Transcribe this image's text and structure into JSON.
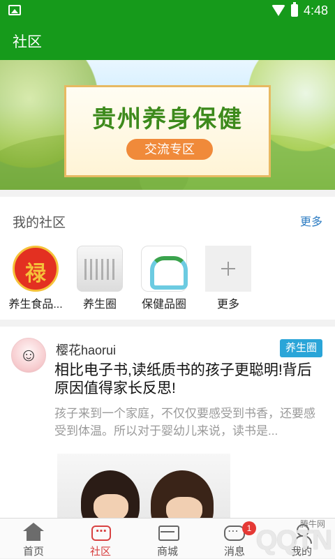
{
  "status_bar": {
    "time": "4:48"
  },
  "app_bar": {
    "title": "社区"
  },
  "banner": {
    "title": "贵州养身保健",
    "subtitle": "交流专区"
  },
  "my_communities": {
    "title": "我的社区",
    "more_label": "更多",
    "items": [
      {
        "label": "养生食品..."
      },
      {
        "label": "养生圈"
      },
      {
        "label": "保健品圈"
      },
      {
        "label": "更多"
      }
    ]
  },
  "post": {
    "username": "樱花haorui",
    "tag": "养生圈",
    "title": "相比电子书,读纸质书的孩子更聪明!背后原因值得家长反思!",
    "body": "孩子来到一个家庭，不仅仅要感受到书香，还要感受到体温。所以对于婴幼儿来说，读书是..."
  },
  "tab_bar": {
    "items": [
      {
        "label": "首页",
        "icon": "home-icon"
      },
      {
        "label": "社区",
        "icon": "community-icon",
        "active": true
      },
      {
        "label": "商城",
        "icon": "shop-icon"
      },
      {
        "label": "消息",
        "icon": "message-icon",
        "badge": "1"
      },
      {
        "label": "我的",
        "icon": "user-icon"
      }
    ]
  },
  "watermark": {
    "small": "腾牛网",
    "logo": "QQTN"
  },
  "colors": {
    "brand_green": "#169a1b",
    "active_red": "#d84141",
    "link_blue": "#2b7bc2",
    "tag_blue": "#2aa5d8"
  }
}
